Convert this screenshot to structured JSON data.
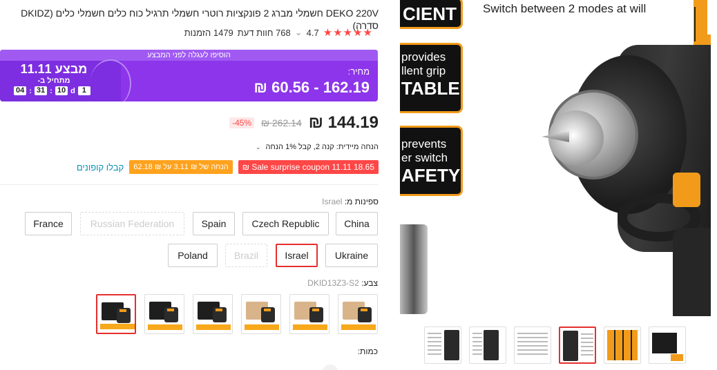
{
  "product": {
    "title": "DEKO 220V חשמלי מברג 2 פונקציות רוטרי חשמלי תרגיל כוח כלים חשמלי כלים (DKIDZ סדרה)",
    "rating": "4.7",
    "reviews": "768 חוות דעת",
    "orders": "1479 הזמנות"
  },
  "promo": {
    "banner": "הוסיפו לעגלה לפני המבצע",
    "event": "מבצע 11.11",
    "starts": "מתחיל ב-",
    "countdown": {
      "days": "1",
      "days_unit": "d",
      "hours": "10",
      "minutes": "31",
      "seconds": "04"
    },
    "price_label": "מחיר:",
    "price_range": "₪ 60.56 - 162.19"
  },
  "price": {
    "current": "₪ 144.19",
    "original": "₪ 262.14",
    "discount": "-45%"
  },
  "instant_discount": "הנחה מיידית: קנה 2, קבל 1% הנחה",
  "coupons": {
    "sale": "₪ Sale surprise coupon 11.11 18.65",
    "store": "הנחה של ₪ 3.11 על ₪ 62.18",
    "get": "קבלו קופונים"
  },
  "ships_from": {
    "label": "ספינות מ:",
    "value": "Israel",
    "options": [
      "China",
      "Czech Republic",
      "Spain",
      "Russian Federation",
      "France",
      "Ukraine",
      "Israel",
      "Brazil",
      "Poland"
    ]
  },
  "color": {
    "label": "צבע:",
    "value": "DKID13Z3-S2"
  },
  "quantity_label": "כמות:",
  "gallery": {
    "card1_big": "CIENT",
    "card2_small1": "provides",
    "card2_small2": "llent grip",
    "card2_big": "TABLE",
    "card3_small1": "prevents",
    "card3_small2": "er switch",
    "card3_big": "AFETY",
    "headline": "Switch between 2 modes at will"
  },
  "colors": {
    "accent": "#8d35ea",
    "sale_red": "#ff4747",
    "coupon_orange": "#ffa21d",
    "link": "#0b93b8",
    "brand_orange": "#f29b1a"
  }
}
